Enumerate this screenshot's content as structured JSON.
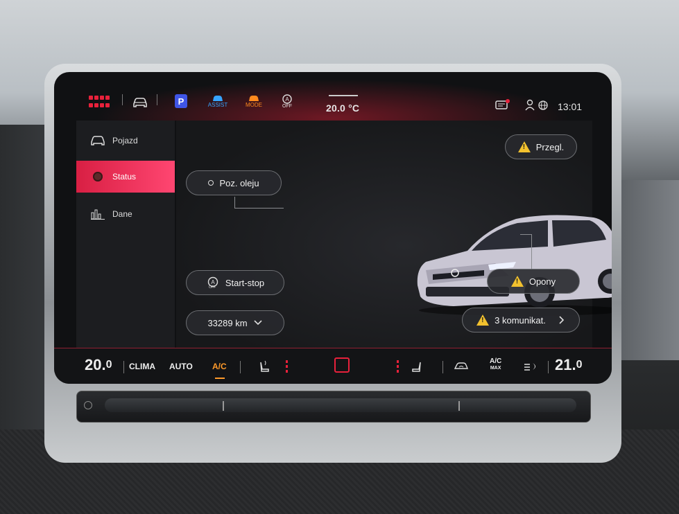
{
  "status_bar": {
    "icons": [
      "apps-grid-icon",
      "car-icon",
      "parking-icon",
      "assist-icon",
      "mode-icon",
      "start-stop-off-icon"
    ],
    "park_label": "P",
    "assist_label": "ASSIST",
    "mode_label": "MODE",
    "off_label": "OFF",
    "temperature": "20.0 °C",
    "time": "13:01",
    "accent_color": "#e8213b"
  },
  "sidebar": {
    "items": [
      {
        "label": "Pojazd",
        "icon": "car-icon"
      },
      {
        "label": "Status",
        "icon": "status-dot-icon",
        "active": true
      },
      {
        "label": "Dane",
        "icon": "bar-chart-icon"
      }
    ]
  },
  "main": {
    "oil_button": "Poz. oleju",
    "start_stop_button": "Start-stop",
    "odometer": "33289 km",
    "service_button": "Przegl.",
    "tires_button": "Opony",
    "messages_button": "3 komunikat.",
    "warning_color": "#f2c12e"
  },
  "climate": {
    "left_temp_main": "20.",
    "left_temp_dec": "0",
    "clima_label": "CLIMA",
    "auto_label": "AUTO",
    "ac_label": "A/C",
    "ac_max_top": "A/C",
    "ac_max_bottom": "MAX",
    "right_temp_main": "21.",
    "right_temp_dec": "0"
  }
}
